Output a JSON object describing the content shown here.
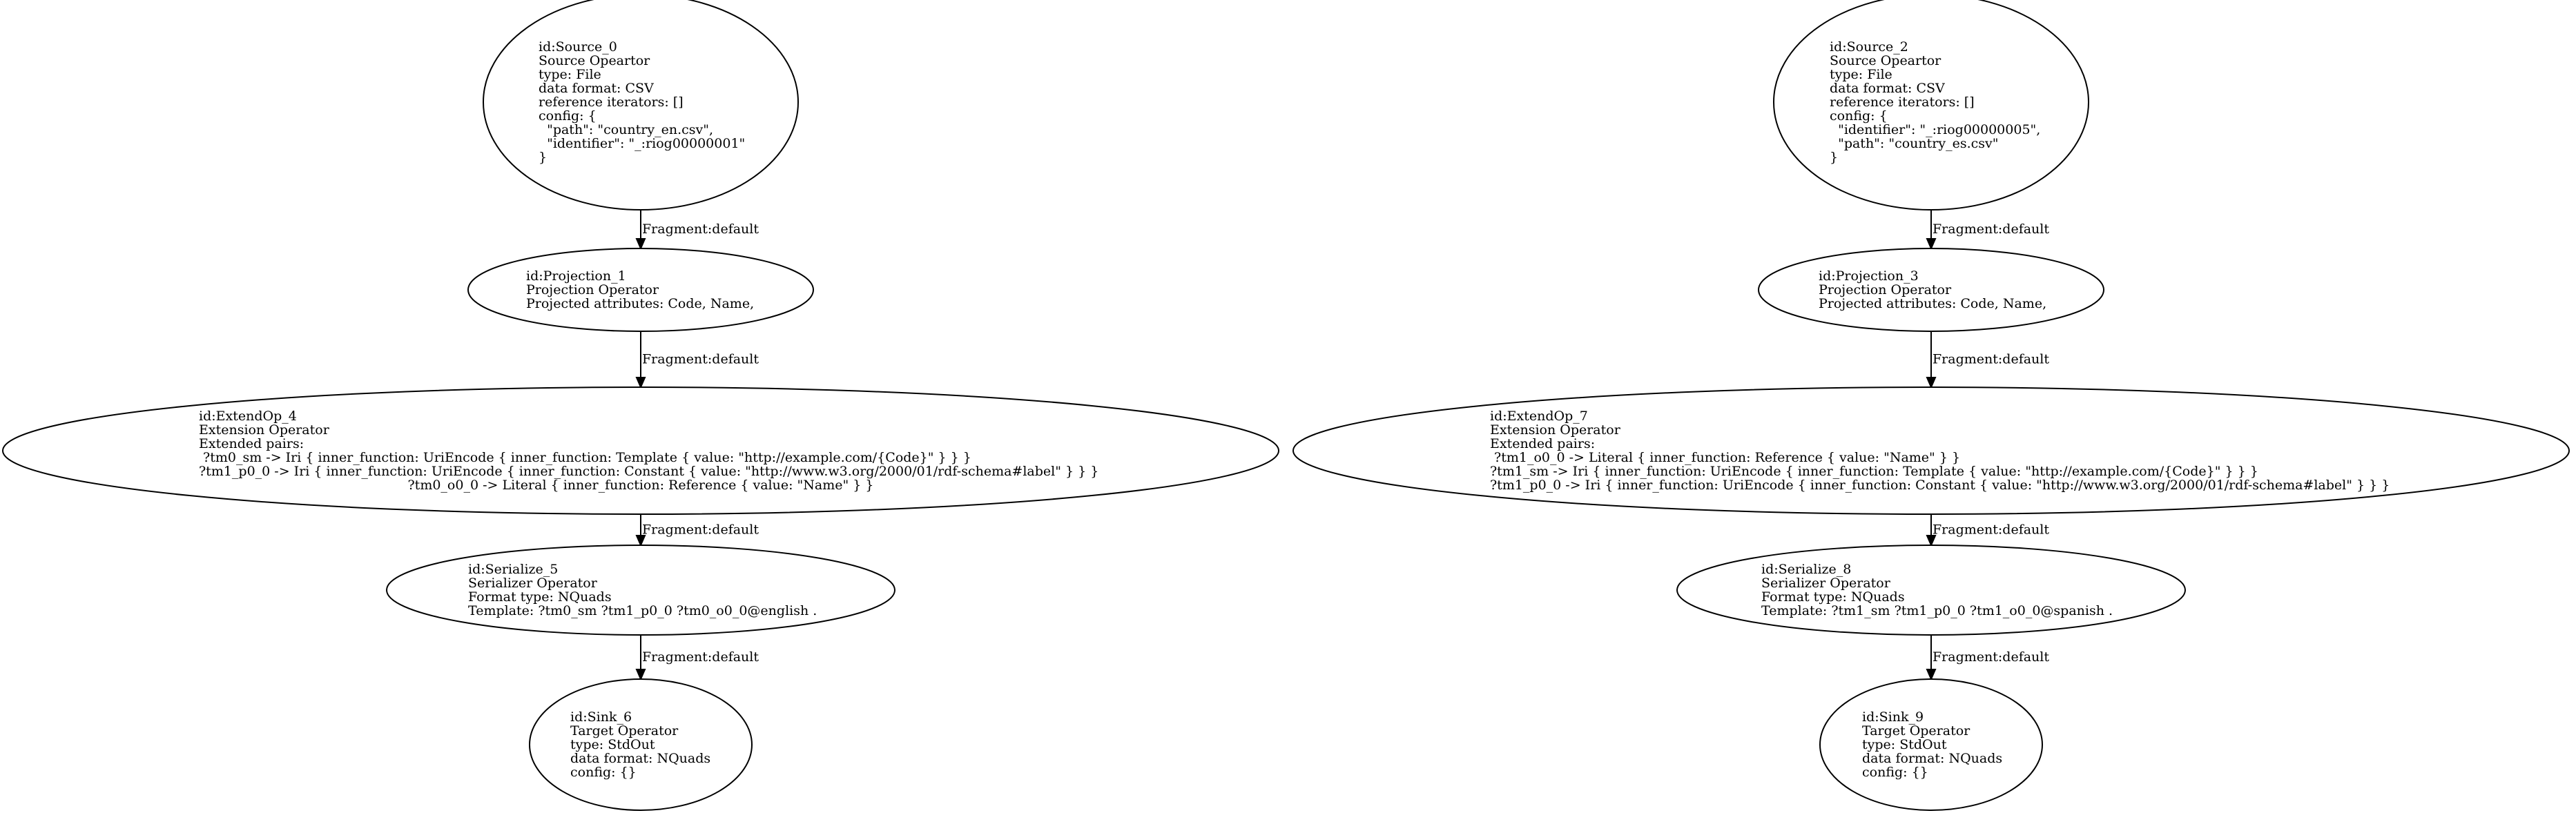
{
  "nodes": [
    {
      "id": "source-0",
      "lines": [
        "id:Source_0",
        "Source Opeartor",
        "type: File",
        "data format: CSV",
        "reference iterators: []",
        "config: {",
        "  \"path\": \"country_en.csv\",",
        "  \"identifier\": \"_:riog00000001\"",
        "}"
      ]
    },
    {
      "id": "projection-1",
      "lines": [
        "id:Projection_1",
        "Projection Operator",
        "Projected attributes: Code, Name,"
      ]
    },
    {
      "id": "extendop-4",
      "lines": [
        "id:ExtendOp_4",
        "Extension Operator",
        "Extended pairs:",
        " ?tm0_sm -> Iri { inner_function: UriEncode { inner_function: Template { value: \"http://example.com/{Code}\" } } }",
        "?tm1_p0_0 -> Iri { inner_function: UriEncode { inner_function: Constant { value: \"http://www.w3.org/2000/01/rdf-schema#label\" } } }",
        "?tm0_o0_0 -> Literal { inner_function: Reference { value: \"Name\" } }"
      ]
    },
    {
      "id": "serialize-5",
      "lines": [
        "id:Serialize_5",
        "Serializer Operator",
        "Format type: NQuads",
        "Template: ?tm0_sm ?tm1_p0_0 ?tm0_o0_0@english ."
      ]
    },
    {
      "id": "sink-6",
      "lines": [
        "id:Sink_6",
        "Target Operator",
        "type: StdOut",
        "data format: NQuads",
        "config: {}"
      ]
    },
    {
      "id": "source-2",
      "lines": [
        "id:Source_2",
        "Source Opeartor",
        "type: File",
        "data format: CSV",
        "reference iterators: []",
        "config: {",
        "  \"identifier\": \"_:riog00000005\",",
        "  \"path\": \"country_es.csv\"",
        "}"
      ]
    },
    {
      "id": "projection-3",
      "lines": [
        "id:Projection_3",
        "Projection Operator",
        "Projected attributes: Code, Name,"
      ]
    },
    {
      "id": "extendop-7",
      "lines": [
        "id:ExtendOp_7",
        "Extension Operator",
        "Extended pairs:",
        " ?tm1_o0_0 -> Literal { inner_function: Reference { value: \"Name\" } }",
        "?tm1_sm -> Iri { inner_function: UriEncode { inner_function: Template { value: \"http://example.com/{Code}\" } } }",
        "?tm1_p0_0 -> Iri { inner_function: UriEncode { inner_function: Constant { value: \"http://www.w3.org/2000/01/rdf-schema#label\" } } }"
      ]
    },
    {
      "id": "serialize-8",
      "lines": [
        "id:Serialize_8",
        "Serializer Operator",
        "Format type: NQuads",
        "Template: ?tm1_sm ?tm1_p0_0 ?tm1_o0_0@spanish ."
      ]
    },
    {
      "id": "sink-9",
      "lines": [
        "id:Sink_9",
        "Target Operator",
        "type: StdOut",
        "data format: NQuads",
        "config: {}"
      ]
    }
  ],
  "edges": [
    {
      "from": "source-0",
      "to": "projection-1",
      "label": "Fragment:default"
    },
    {
      "from": "projection-1",
      "to": "extendop-4",
      "label": "Fragment:default"
    },
    {
      "from": "extendop-4",
      "to": "serialize-5",
      "label": "Fragment:default"
    },
    {
      "from": "serialize-5",
      "to": "sink-6",
      "label": "Fragment:default"
    },
    {
      "from": "source-2",
      "to": "projection-3",
      "label": "Fragment:default"
    },
    {
      "from": "projection-3",
      "to": "extendop-7",
      "label": "Fragment:default"
    },
    {
      "from": "extendop-7",
      "to": "serialize-8",
      "label": "Fragment:default"
    },
    {
      "from": "serialize-8",
      "to": "sink-9",
      "label": "Fragment:default"
    }
  ]
}
